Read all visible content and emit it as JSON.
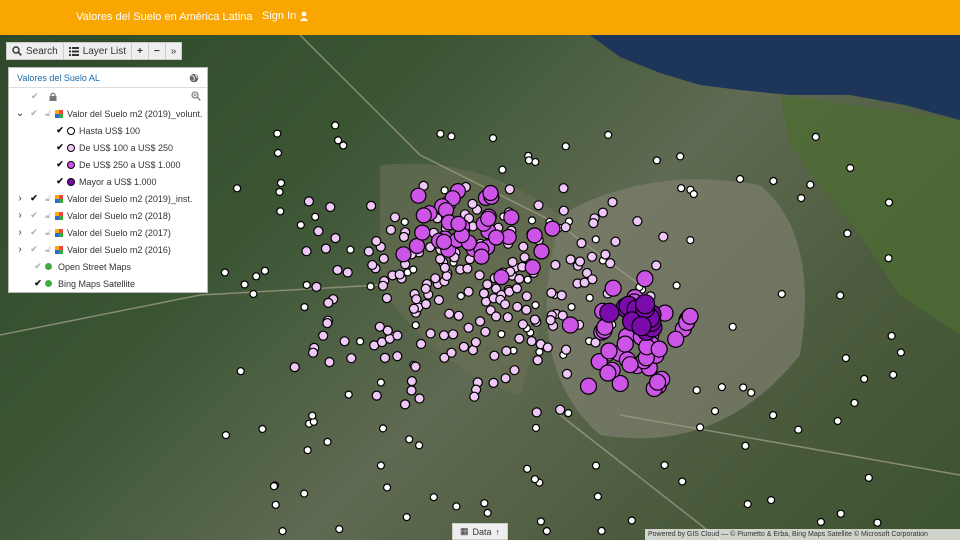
{
  "header": {
    "title": "Valores del Suelo en América Latina",
    "sign_in": "Sign In"
  },
  "toolbar": {
    "search": "Search",
    "layer_list": "Layer List",
    "zoom_in": "+",
    "zoom_out": "−",
    "collapse": "»"
  },
  "panel": {
    "title": "Valores del Suelo AL",
    "layers": [
      {
        "label": "Valor del Suelo m2 (2019)_volunt.",
        "expanded": true,
        "checked": false
      },
      {
        "label": "Valor del Suelo m2 (2019)_inst.",
        "expanded": false,
        "checked": true
      },
      {
        "label": "Valor del Suelo m2 (2018)",
        "expanded": false,
        "checked": false
      },
      {
        "label": "Valor del Suelo m2 (2017)",
        "expanded": false,
        "checked": false
      },
      {
        "label": "Valor del Suelo m2 (2016)",
        "expanded": false,
        "checked": false
      }
    ],
    "legend": [
      {
        "label": "Hasta US$ 100",
        "color": "#ffffff"
      },
      {
        "label": "De US$ 100 a US$ 250",
        "color": "#f0c8f8"
      },
      {
        "label": "De US$ 250 a US$ 1.000",
        "color": "#cc55e8"
      },
      {
        "label": "Mayor a US$ 1.000",
        "color": "#7a0aaa"
      }
    ],
    "basemaps": [
      {
        "label": "Open Street Maps"
      },
      {
        "label": "Bing Maps Satellite"
      }
    ]
  },
  "data_tab": "Data",
  "attribution": "Powered by GIS Cloud — © Piumetto & Erba, Bing Maps Satellite © Microsoft Corporation",
  "colors": {
    "header": "#f9a600",
    "water": "#1c3558",
    "point_stroke": "#000000"
  },
  "icons": {
    "sign_in": "user-icon",
    "search": "search-icon",
    "layers": "list-icon",
    "globe": "globe-icon",
    "zoom": "zoom-icon",
    "lock": "lock-icon",
    "check": "check-icon",
    "data": "arrow-up-icon"
  }
}
